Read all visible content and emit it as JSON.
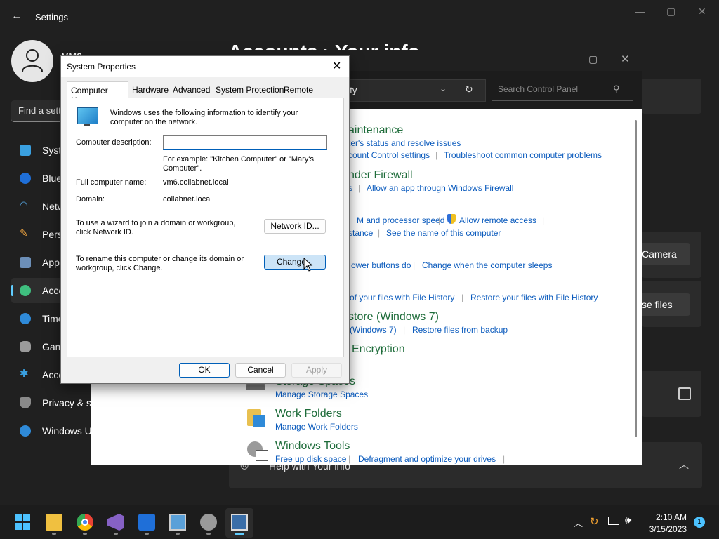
{
  "settings": {
    "title": "Settings",
    "user_name": "VM6",
    "heading": "Accounts  ›  Your info",
    "search_placeholder": "Find a setting",
    "nav": [
      {
        "label": "System",
        "icon": "monitor-icon"
      },
      {
        "label": "Bluetooth & devices",
        "icon": "bluetooth-icon"
      },
      {
        "label": "Network & internet",
        "icon": "wifi-icon"
      },
      {
        "label": "Personalization",
        "icon": "brush-icon"
      },
      {
        "label": "Apps",
        "icon": "apps-icon"
      },
      {
        "label": "Accounts",
        "icon": "person-icon"
      },
      {
        "label": "Time & language",
        "icon": "clock-icon"
      },
      {
        "label": "Gaming",
        "icon": "gamepad-icon"
      },
      {
        "label": "Accessibility",
        "icon": "accessibility-icon"
      },
      {
        "label": "Privacy & security",
        "icon": "shield-icon"
      },
      {
        "label": "Windows Update",
        "icon": "update-icon"
      }
    ],
    "camera_button": "Camera",
    "browse_button": "se files",
    "help_text": "Help with Your info"
  },
  "control_panel": {
    "address_text": "rity",
    "search_placeholder": "Search Control Panel",
    "categories": [
      {
        "title": "aintenance",
        "links": [
          "ter's status and resolve issues",
          "count Control settings",
          "Troubleshoot common computer problems"
        ]
      },
      {
        "title": "nder Firewall",
        "links": [
          "s",
          "Allow an app through Windows Firewall"
        ]
      },
      {
        "title": "",
        "links": [
          "M and processor speed",
          "Allow remote access",
          "stance",
          "See the name of this computer"
        ]
      },
      {
        "title": "",
        "links": [
          "ower buttons do",
          "Change when the computer sleeps"
        ]
      },
      {
        "title": "",
        "links": [
          "of your files with File History",
          "Restore your files with File History"
        ]
      },
      {
        "title": "store (Windows 7)",
        "links": [
          "(Windows 7)",
          "Restore files from backup"
        ]
      },
      {
        "title": "Encryption",
        "links": []
      },
      {
        "title": "Storage Spaces",
        "links": [
          "Manage Storage Spaces"
        ]
      },
      {
        "title": "Work Folders",
        "links": [
          "Manage Work Folders"
        ]
      },
      {
        "title": "Windows Tools",
        "links": [
          "Free up disk space",
          "Defragment and optimize your drives"
        ]
      }
    ]
  },
  "dialog": {
    "title": "System Properties",
    "tabs": [
      "Computer Name",
      "Hardware",
      "Advanced",
      "System Protection",
      "Remote"
    ],
    "intro": "Windows uses the following information to identify your computer on the network.",
    "description_label": "Computer description:",
    "description_value": "",
    "example_text": "For example: \"Kitchen Computer\" or \"Mary's Computer\".",
    "full_name_label": "Full computer name:",
    "full_name_value": "vm6.collabnet.local",
    "domain_label": "Domain:",
    "domain_value": "collabnet.local",
    "wizard_text": "To use a wizard to join a domain or workgroup, click Network ID.",
    "network_id_button": "Network ID...",
    "rename_text": "To rename this computer or change its domain or workgroup, click Change.",
    "change_button": "Change...",
    "ok_button": "OK",
    "cancel_button": "Cancel",
    "apply_button": "Apply"
  },
  "taskbar": {
    "time": "2:10 AM",
    "date": "3/15/2023",
    "notification_count": "1"
  }
}
